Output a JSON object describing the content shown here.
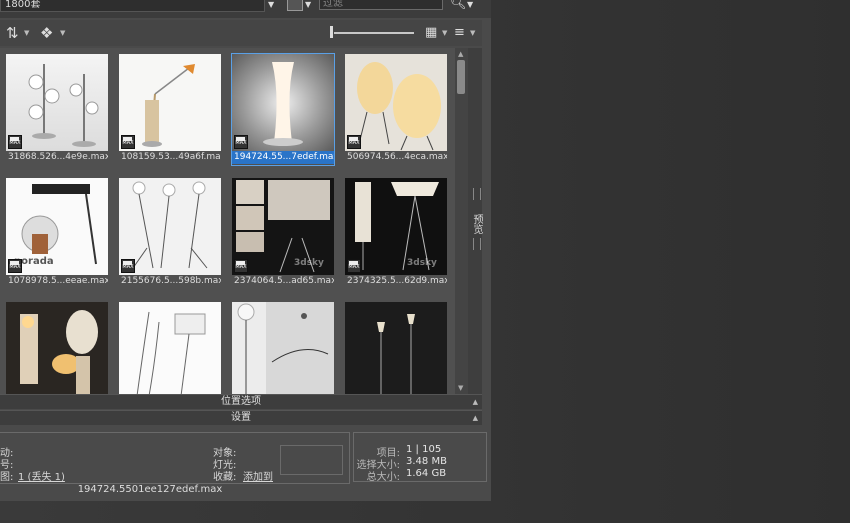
{
  "topbar": {
    "path_text": "1800套",
    "filter_placeholder": "过滤"
  },
  "toolbar": {
    "sync_icon": "sync-icon",
    "object_icon": "object-icon",
    "grid_icon": "grid-view-icon",
    "sort_icon": "sort-icon"
  },
  "thumbnails": [
    {
      "caption": "31868.526...4e9e.max"
    },
    {
      "caption": "108159.53...49a6f.max"
    },
    {
      "caption": "194724.55...7edef.max",
      "selected": true
    },
    {
      "caption": "506974.56...4eca.max"
    },
    {
      "caption": "1078978.5...eeae.max",
      "brand": "porada"
    },
    {
      "caption": "2155676.5...598b.max"
    },
    {
      "caption": "2374064.5...ad65.max",
      "watermark": "3dsky"
    },
    {
      "caption": "2374325.5...62d9.max",
      "watermark": "3dsky"
    },
    {
      "caption": ""
    },
    {
      "caption": ""
    },
    {
      "caption": ""
    },
    {
      "caption": ""
    }
  ],
  "sections": {
    "location_options": "位置选项",
    "settings": "设置"
  },
  "side_tab": "预览",
  "info": {
    "label_a": "动:",
    "label_b": "号:",
    "label_c": "图:",
    "link_c": "1 (丢失 1)",
    "object_label": "对象:",
    "light_label": "灯光:",
    "favorite_label": "收藏:",
    "favorite_link": "添加到"
  },
  "stats": {
    "items_label": "项目:",
    "items_value": "1 | 105",
    "sel_size_label": "选择大小:",
    "sel_size_value": "3.48 MB",
    "total_size_label": "总大小:",
    "total_size_value": "1.64 GB"
  },
  "filename": "194724.5501ee127edef.max"
}
